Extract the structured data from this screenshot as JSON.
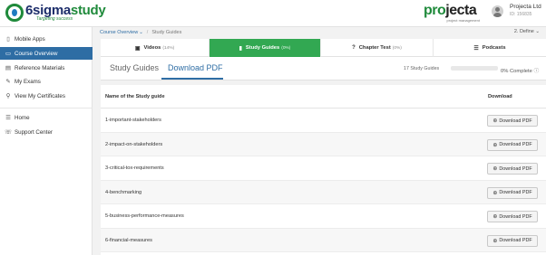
{
  "header": {
    "logo_brand_main": "6sigma",
    "logo_brand_accent": "study",
    "logo_tagline": "Targeting success",
    "partner_name_green": "pro",
    "partner_name_dark": "jecta",
    "partner_tagline": "project management",
    "user_name": "Projecta Ltd",
    "user_id": "ID: 156835"
  },
  "sidebar": {
    "items": [
      {
        "label": "Mobile Apps",
        "icon": "mobile-icon",
        "glyph": "▯"
      },
      {
        "label": "Course Overview",
        "icon": "monitor-icon",
        "glyph": "▭"
      },
      {
        "label": "Reference Materials",
        "icon": "document-icon",
        "glyph": "▤"
      },
      {
        "label": "My Exams",
        "icon": "edit-icon",
        "glyph": "✎"
      },
      {
        "label": "View My Certificates",
        "icon": "certificate-icon",
        "glyph": "⚲"
      },
      {
        "label": "Home",
        "icon": "list-icon",
        "glyph": "☰"
      },
      {
        "label": "Support Center",
        "icon": "support-icon",
        "glyph": "☏"
      }
    ]
  },
  "breadcrumb": {
    "link": "Course Overview",
    "chevron": "⌄",
    "current": "Study Guides",
    "define": "2. Define ⌄"
  },
  "tabs": [
    {
      "label": "Videos",
      "count": "(14%)",
      "glyph": "▣"
    },
    {
      "label": "Study Guides",
      "count": "(0%)",
      "glyph": "▮"
    },
    {
      "label": "Chapter Test",
      "count": "(0%)",
      "glyph": "?"
    },
    {
      "label": "Podcasts",
      "count": "",
      "glyph": "☰"
    }
  ],
  "subhead": {
    "study_guides_tab": "Study Guides",
    "download_pdf_tab": "Download PDF",
    "count_text": "17 Study Guides",
    "progress_fraction": 0,
    "complete_text": "0% Complete",
    "info_glyph": "ⓘ"
  },
  "table": {
    "col_name": "Name of the Study guide",
    "col_download": "Download",
    "button_label": "Download PDF",
    "button_glyph": "⊕",
    "rows": [
      "1-important-stakeholders",
      "2-impact-on-stakeholders",
      "3-critical-tox-requirements",
      "4-benchmarking",
      "5-business-performance-measures",
      "6-financial-measures"
    ]
  },
  "colors": {
    "accent_blue": "#2e6da4",
    "accent_green": "#32a852"
  }
}
